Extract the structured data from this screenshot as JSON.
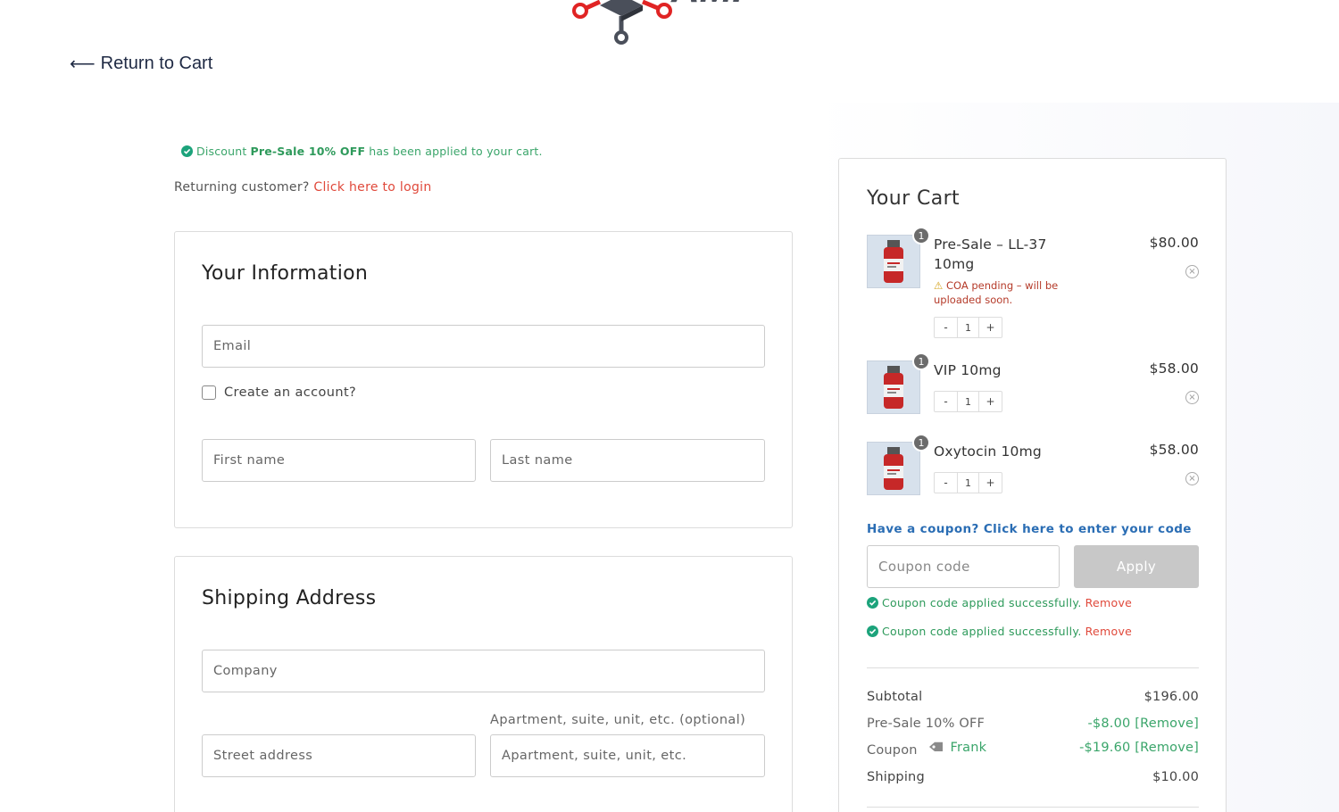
{
  "header": {
    "logo_text": "AMI",
    "return_link": "Return to Cart",
    "return_arrow": "⟵"
  },
  "notice": {
    "prefix": "Discount ",
    "bold": "Pre-Sale 10% OFF",
    "suffix": " has been applied to your cart."
  },
  "returning": {
    "text": "Returning customer? ",
    "link": "Click here to login"
  },
  "your_information": {
    "title": "Your Information",
    "email_placeholder": "Email",
    "create_account_label": "Create an account?",
    "first_name_placeholder": "First name",
    "last_name_placeholder": "Last name"
  },
  "shipping": {
    "title": "Shipping Address",
    "company_placeholder": "Company",
    "apartment_label": "Apartment, suite, unit, etc. (optional)",
    "street_placeholder": "Street address",
    "apartment_placeholder": "Apartment, suite, unit, etc."
  },
  "cart": {
    "title": "Your Cart",
    "items": [
      {
        "name_line1": "Pre-Sale – LL-37",
        "name_line2": "10mg",
        "price": "$80.00",
        "qty": "1",
        "badge": "1",
        "warning_icon": "⚠",
        "warning": "COA pending – will be uploaded soon."
      },
      {
        "name_line1": "VIP 10mg",
        "price": "$58.00",
        "qty": "1",
        "badge": "1"
      },
      {
        "name_line1": "Oxytocin 10mg",
        "price": "$58.00",
        "qty": "1",
        "badge": "1"
      }
    ],
    "stepper_minus": "-",
    "stepper_plus": "+",
    "remove_symbol": "×",
    "coupon_link": "Have a coupon? Click here to enter your code",
    "coupon_placeholder": "Coupon code",
    "apply_label": "Apply",
    "coupon_success": "Coupon code applied successfully.",
    "coupon_remove": "Remove",
    "summary": {
      "subtotal_label": "Subtotal",
      "subtotal_value": "$196.00",
      "presale_label": "Pre-Sale 10% OFF",
      "presale_value": "-$8.00 [Remove]",
      "coupon_label": "Coupon",
      "coupon_name": "Frank",
      "coupon_value": "-$19.60 [Remove]",
      "shipping_label": "Shipping",
      "shipping_value": "$10.00"
    }
  },
  "colors": {
    "success_green": "#2e9a5b",
    "link_red": "#e0493b",
    "link_blue": "#2a6db4",
    "apply_disabled": "#c8c8c8"
  }
}
